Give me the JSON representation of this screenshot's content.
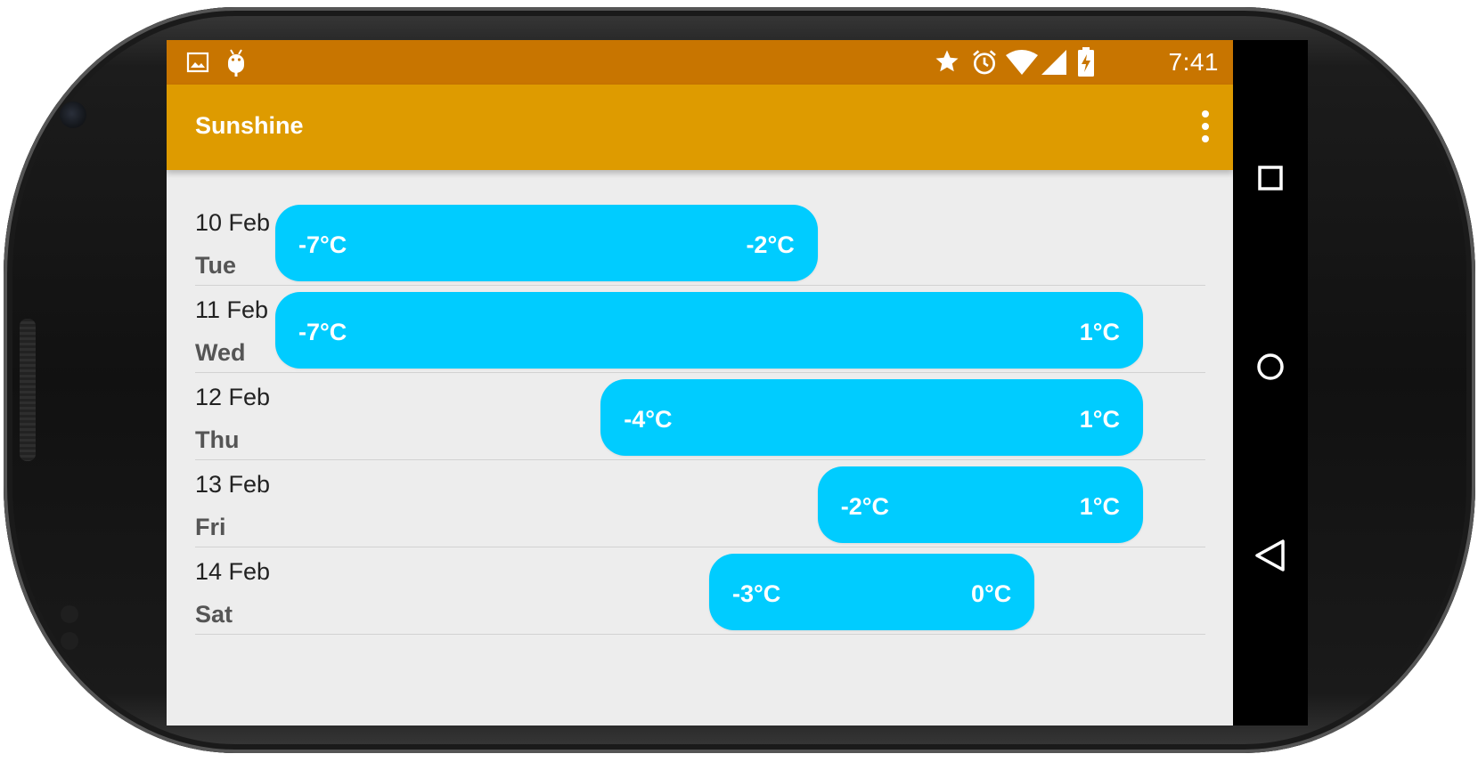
{
  "status_bar": {
    "time": "7:41",
    "icons": [
      "image-icon",
      "android-debug-icon",
      "star-icon",
      "alarm-icon",
      "wifi-icon",
      "cell-signal-icon",
      "battery-charging-icon"
    ]
  },
  "app_bar": {
    "title": "Sunshine",
    "overflow_icon": "more-vert-icon"
  },
  "forecast": [
    {
      "date": "10 Feb",
      "day": "Tue",
      "low": "-7°C",
      "high": "-2°C",
      "low_value": -7,
      "high_value": -2
    },
    {
      "date": "11 Feb",
      "day": "Wed",
      "low": "-7°C",
      "high": "1°C",
      "low_value": -7,
      "high_value": 1
    },
    {
      "date": "12 Feb",
      "day": "Thu",
      "low": "-4°C",
      "high": "1°C",
      "low_value": -4,
      "high_value": 1
    },
    {
      "date": "13 Feb",
      "day": "Fri",
      "low": "-2°C",
      "high": "1°C",
      "low_value": -2,
      "high_value": 1
    },
    {
      "date": "14 Feb",
      "day": "Sat",
      "low": "-3°C",
      "high": "0°C",
      "low_value": -3,
      "high_value": 0
    }
  ],
  "nav_bar": {
    "buttons": [
      "recents-icon",
      "home-icon",
      "back-icon"
    ]
  },
  "colors": {
    "status_bar": "#c87500",
    "app_bar": "#de9b00",
    "temperature_bar": "#00ccff",
    "background": "#ededed"
  }
}
